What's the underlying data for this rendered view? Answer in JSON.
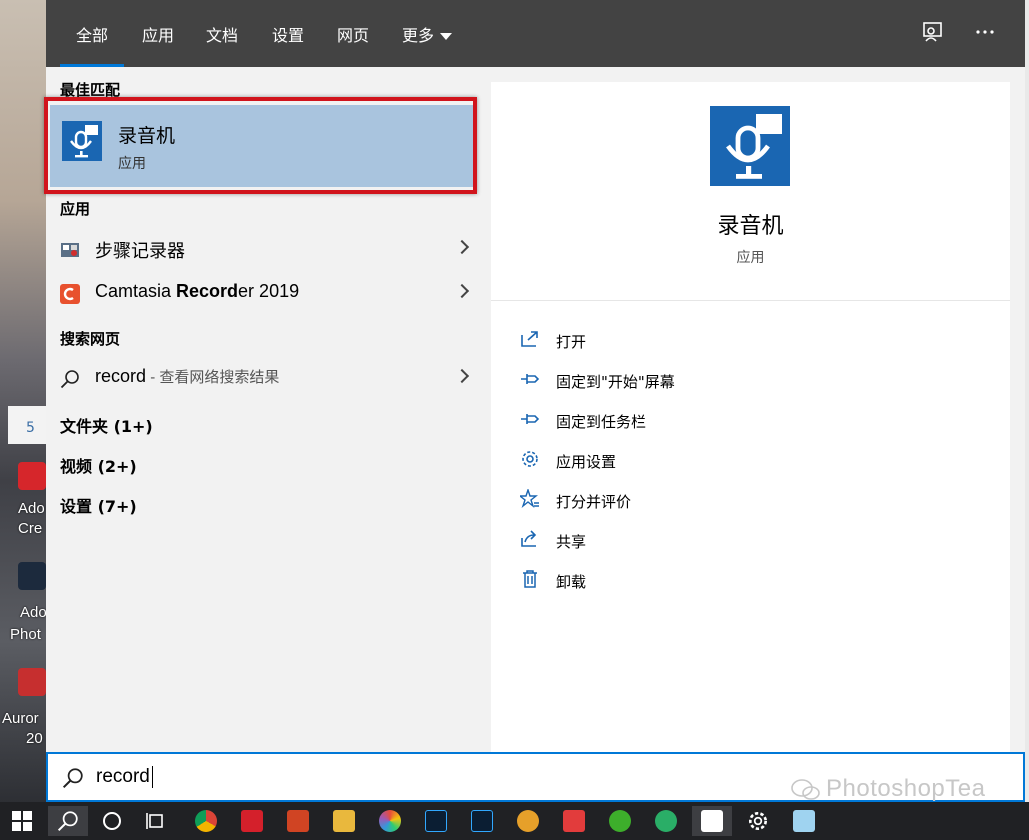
{
  "tabs": [
    "全部",
    "应用",
    "文档",
    "设置",
    "网页",
    "更多"
  ],
  "sections": {
    "best_match": "最佳匹配",
    "apps": "应用",
    "web": "搜索网页"
  },
  "best_match": {
    "title": "录音机",
    "subtitle": "应用"
  },
  "apps": [
    {
      "label": "步骤记录器"
    },
    {
      "label_pre": "Camtasia ",
      "label_bold": "Record",
      "label_post": "er 2019"
    }
  ],
  "web": {
    "query": "record",
    "hint": " - 查看网络搜索结果"
  },
  "groups": [
    "文件夹 (1+)",
    "视频 (2+)",
    "设置 (7+)"
  ],
  "detail": {
    "title": "录音机",
    "subtitle": "应用",
    "actions": [
      {
        "label": "打开",
        "icon": "open-icon"
      },
      {
        "label": "固定到\"开始\"屏幕",
        "icon": "pin-icon"
      },
      {
        "label": "固定到任务栏",
        "icon": "pin-icon"
      },
      {
        "label": "应用设置",
        "icon": "gear-icon"
      },
      {
        "label": "打分并评价",
        "icon": "star-icon"
      },
      {
        "label": "共享",
        "icon": "share-icon"
      },
      {
        "label": "卸载",
        "icon": "trash-icon"
      }
    ]
  },
  "search": {
    "value": "record"
  },
  "watermark": "PhotoshopTea",
  "desktop": {
    "labels": [
      "Ado",
      "Cre",
      "Ado",
      "Phot",
      "Auror",
      "20"
    ],
    "badge": "5"
  },
  "colors": {
    "accent": "#0078d7",
    "highlight": "#a9c4de",
    "outline": "#d1141c",
    "app_icon": "#1a66b2"
  }
}
